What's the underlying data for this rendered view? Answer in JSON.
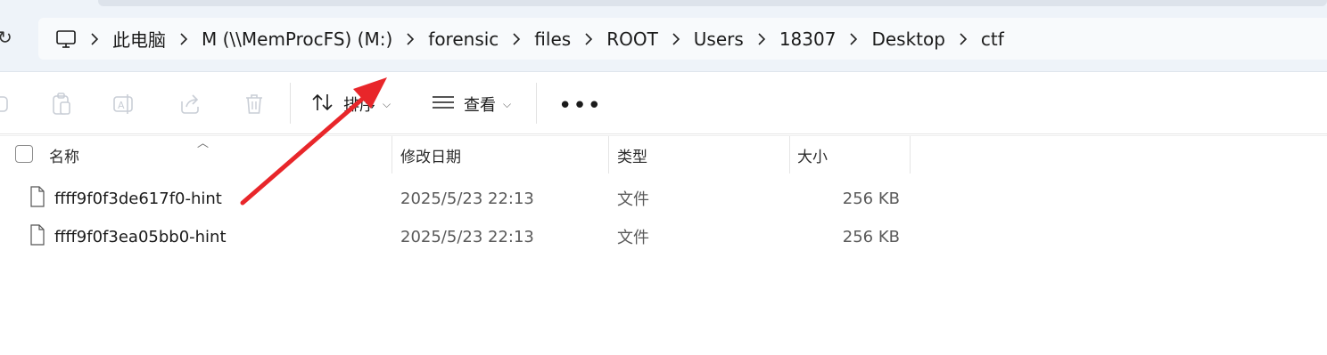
{
  "address": {
    "breadcrumbs": [
      "此电脑",
      "M (\\\\MemProcFS) (M:)",
      "forensic",
      "files",
      "ROOT",
      "Users",
      "18307",
      "Desktop",
      "ctf"
    ]
  },
  "toolbar": {
    "sort_label": "排序",
    "view_label": "查看"
  },
  "columns": {
    "name": "名称",
    "date": "修改日期",
    "type": "类型",
    "size": "大小"
  },
  "files": [
    {
      "name": "ffff9f0f3de617f0-hint",
      "date": "2025/5/23 22:13",
      "type": "文件",
      "size": "256 KB"
    },
    {
      "name": "ffff9f0f3ea05bb0-hint",
      "date": "2025/5/23 22:13",
      "type": "文件",
      "size": "256 KB"
    }
  ],
  "colors": {
    "annotation_arrow": "#e8262a",
    "topbar_bg": "#eef3f9"
  }
}
